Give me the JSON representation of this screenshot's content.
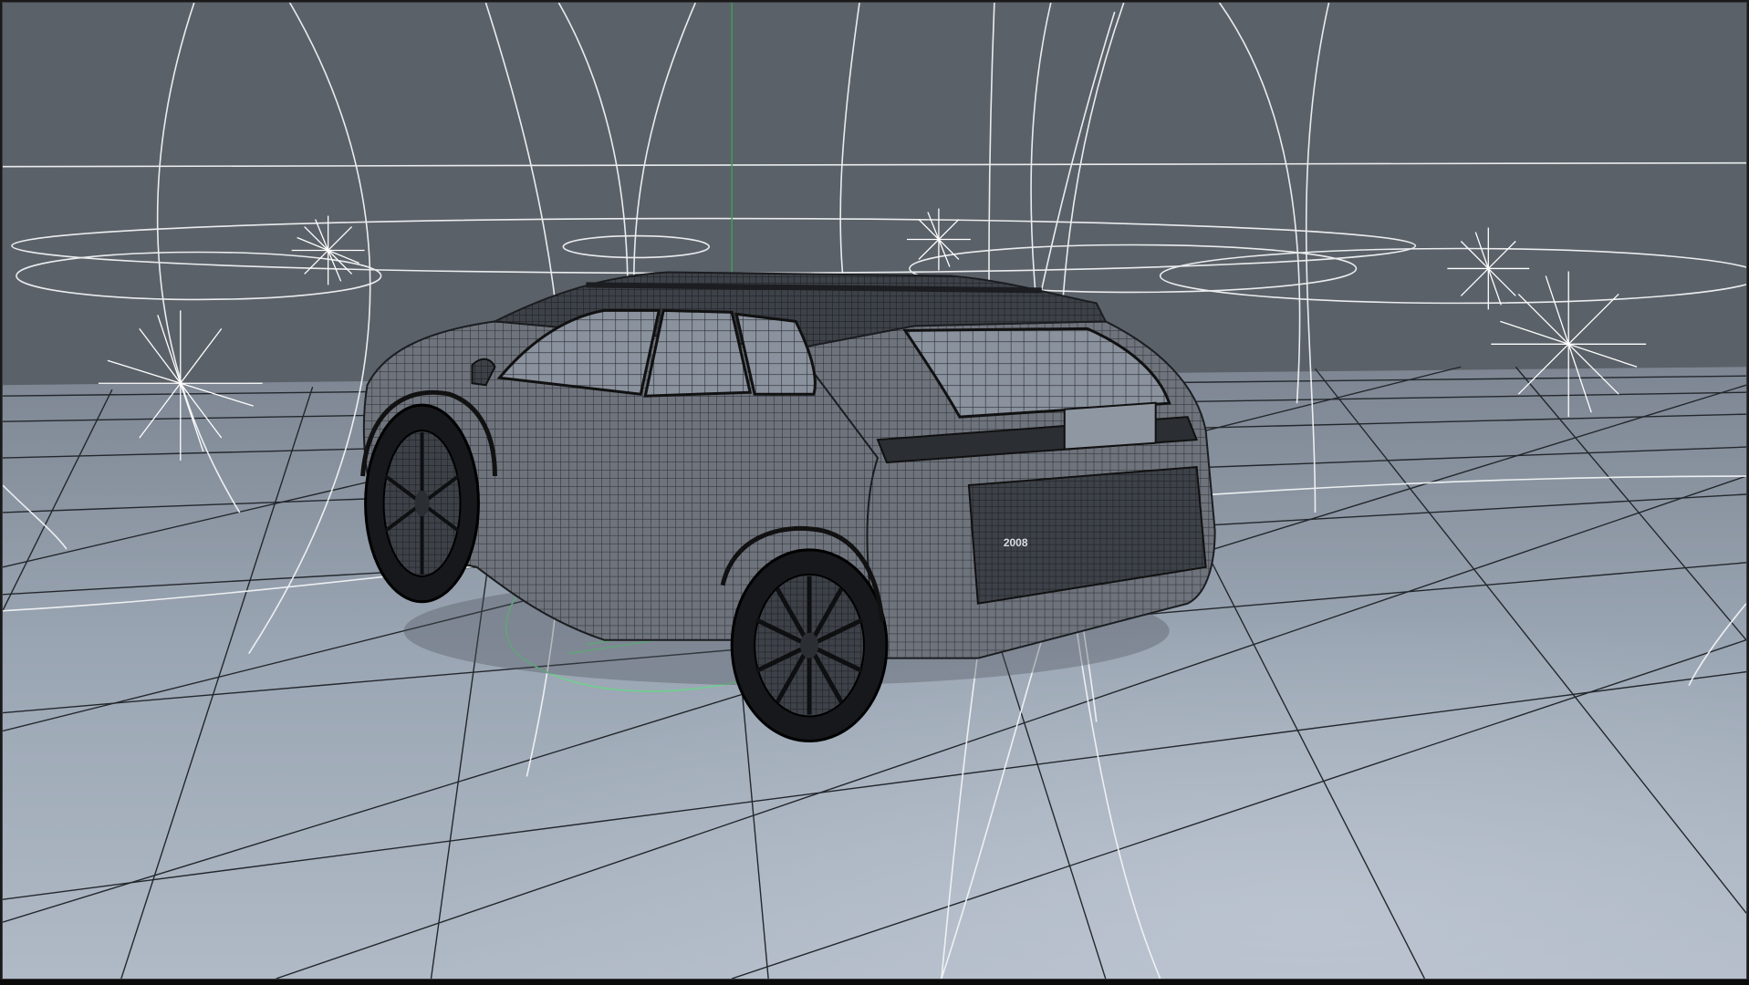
{
  "viewport": {
    "label": "",
    "colors": {
      "background": "#5b6168",
      "floor_near": "#a9b3c0",
      "floor_far": "#7f8894",
      "grid_line": "#1f2327",
      "light_gizmo": "#ffffff",
      "selection": "#6fd08c",
      "wire_mesh": "#2a2d31",
      "body_fill": "#6b7079"
    },
    "badge_text": "2008"
  }
}
